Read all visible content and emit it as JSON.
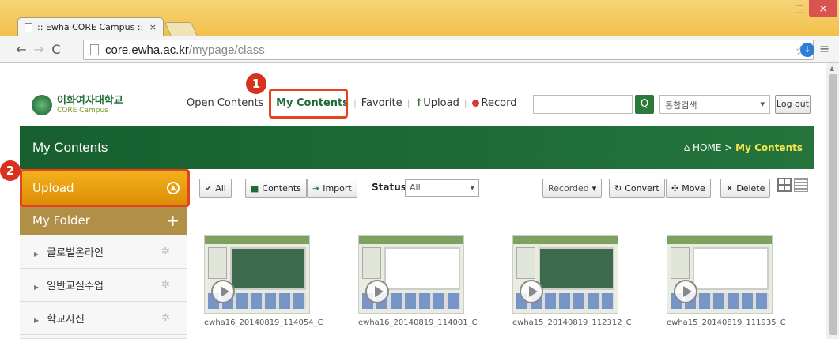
{
  "browser": {
    "tab_title": ":: Ewha CORE Campus ::",
    "tab_close": "×",
    "url_host": "core.ewha.ac.kr",
    "url_path": "/mypage/class",
    "win_min": "‒",
    "win_max": "□",
    "win_close": "×"
  },
  "header": {
    "logo_ko": "이화여자대학교",
    "logo_en": "CORE Campus",
    "nav": {
      "open_contents": "Open Contents",
      "my_contents": "My Contents",
      "favorite": "Favorite",
      "upload": "Upload",
      "record": "Record"
    },
    "search_button": "Q",
    "search_scope": "통합검색",
    "logout": "Log out"
  },
  "banner": {
    "title": "My Contents",
    "breadcrumb_home": "HOME",
    "breadcrumb_sep": ">",
    "breadcrumb_current": "My Contents"
  },
  "sidebar": {
    "upload": "Upload",
    "my_folder": "My Folder",
    "add": "+",
    "items": [
      {
        "label": "글로벌온라인"
      },
      {
        "label": "일반교실수업"
      },
      {
        "label": "학교사진"
      }
    ]
  },
  "toolbar": {
    "all": "All",
    "contents": "Contents",
    "import": "Import",
    "status_label": "Status",
    "status_value": "All",
    "recorded": "Recorded",
    "convert": "Convert",
    "move": "Move",
    "delete": "Delete"
  },
  "items": [
    {
      "label": "ewha16_20140819_114054_C"
    },
    {
      "label": "ewha16_20140819_114001_C"
    },
    {
      "label": "ewha15_20140819_112312_C"
    },
    {
      "label": "ewha15_20140819_111935_C"
    }
  ],
  "callouts": [
    "1",
    "2"
  ],
  "colors": {
    "brand_green": "#1f6b35",
    "upload_orange": "#e89a10",
    "callout_red": "#e64222"
  }
}
